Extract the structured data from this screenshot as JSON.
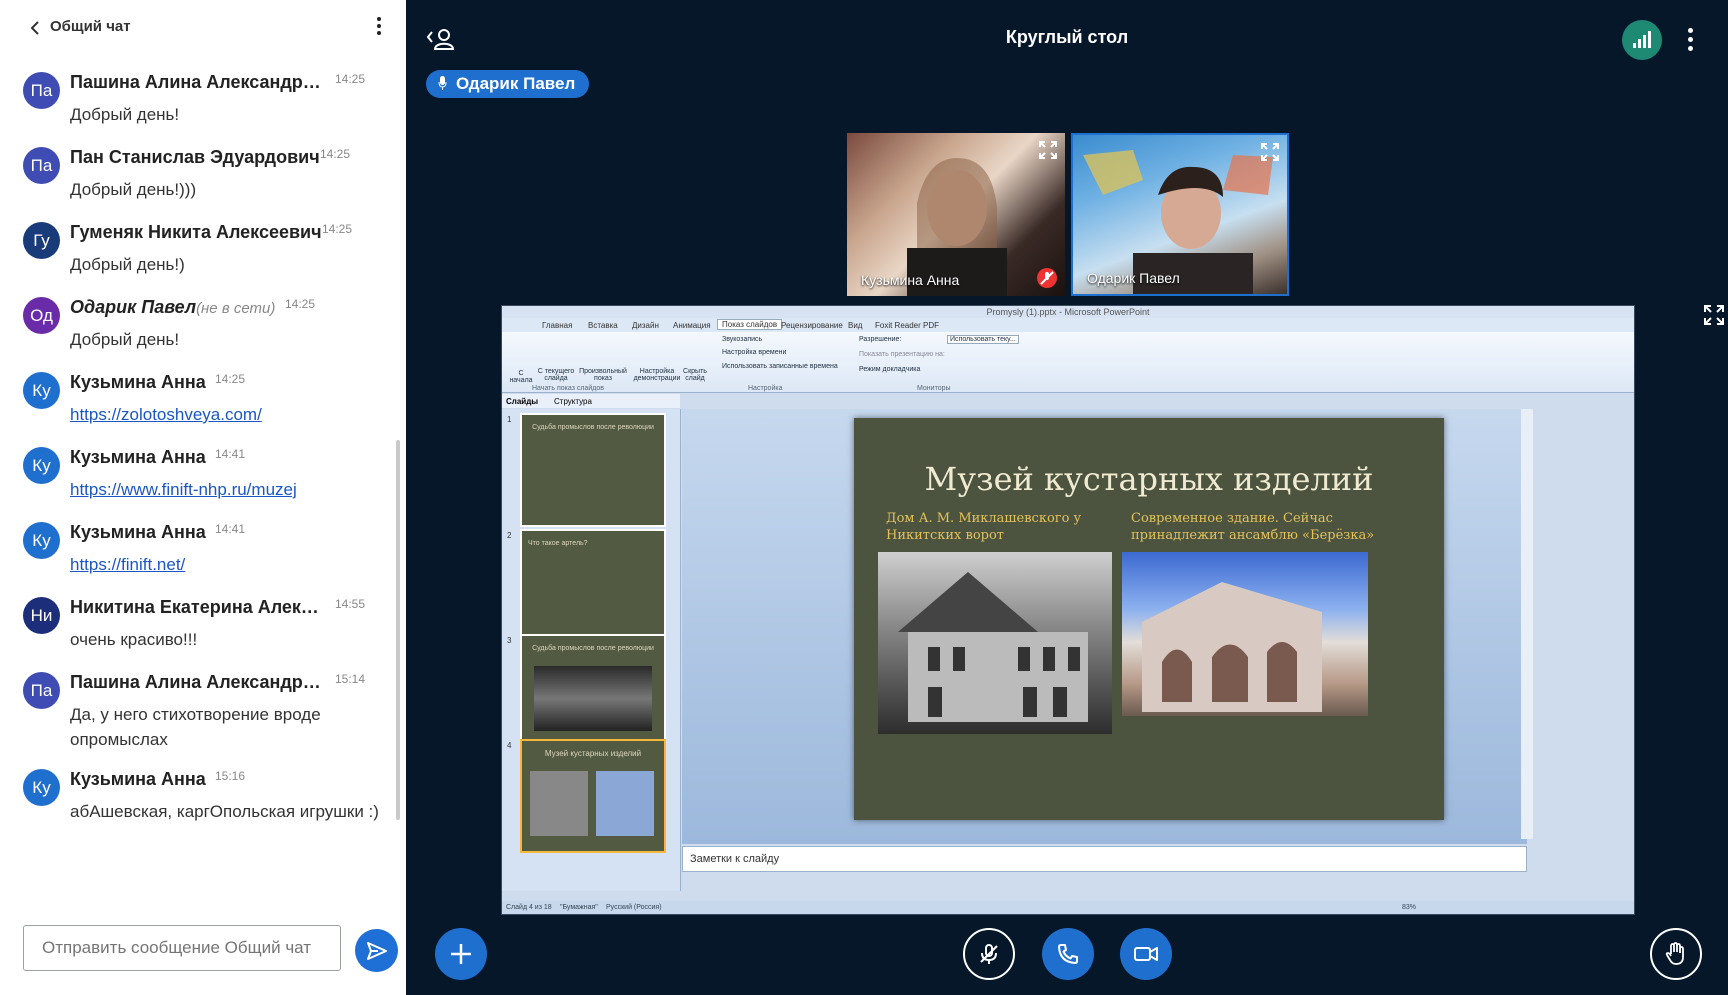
{
  "chat": {
    "title": "Общий чат",
    "input_placeholder": "Отправить сообщение Общий чат",
    "messages": [
      {
        "initials": "Па",
        "color": "#3e4cb3",
        "sender": "Пашина Алина Александро...",
        "note": "",
        "time": "14:25",
        "text": "Добрый день!",
        "link": false
      },
      {
        "initials": "Па",
        "color": "#3e4cb3",
        "sender": "Пан Станислав Эдуардович",
        "note": "",
        "time": "14:25",
        "text": "Добрый день!)))",
        "link": false
      },
      {
        "initials": "Гу",
        "color": "#1a3b7a",
        "sender": "Гуменяк Никита Алексеевич",
        "note": "",
        "time": "14:25",
        "text": "Добрый день!)",
        "link": false
      },
      {
        "initials": "Од",
        "color": "#6a2ba8",
        "sender": "Одарик Павел",
        "note": "(не в сети)",
        "time": "14:25",
        "text": "Добрый день!",
        "link": false
      },
      {
        "initials": "Ку",
        "color": "#1f6fcf",
        "sender": "Кузьмина Анна",
        "note": "",
        "time": "14:25",
        "text": "https://zolotoshveya.com/",
        "link": true
      },
      {
        "initials": "Ку",
        "color": "#1f6fcf",
        "sender": "Кузьмина Анна",
        "note": "",
        "time": "14:41",
        "text": "https://www.finift-nhp.ru/muzej",
        "link": true
      },
      {
        "initials": "Ку",
        "color": "#1f6fcf",
        "sender": "Кузьмина Анна",
        "note": "",
        "time": "14:41",
        "text": "https://finift.net/",
        "link": true
      },
      {
        "initials": "Ни",
        "color": "#1c2d7a",
        "sender": "Никитина Екатерина Алекс...",
        "note": "",
        "time": "14:55",
        "text": "очень красиво!!!",
        "link": false
      },
      {
        "initials": "Па",
        "color": "#3e4cb3",
        "sender": "Пашина Алина Александро...",
        "note": "",
        "time": "15:14",
        "text": "Да, у него стихотворение вроде\nопромыслах",
        "link": false
      },
      {
        "initials": "Ку",
        "color": "#1f6fcf",
        "sender": "Кузьмина Анна",
        "note": "",
        "time": "15:16",
        "text": "абАшевская, каргОпольская игрушки :)",
        "link": false
      }
    ]
  },
  "main": {
    "title": "Круглый стол",
    "speaker": "Одарик Павел",
    "videos": [
      {
        "name": "Кузьмина Анна",
        "muted": true
      },
      {
        "name": "Одарик Павел",
        "muted": false
      }
    ]
  },
  "presentation": {
    "window_title": "Promysly (1).pptx - Microsoft PowerPoint",
    "tabs": [
      "Главная",
      "Вставка",
      "Дизайн",
      "Анимация",
      "Показ слайдов",
      "Рецензирование",
      "Вид",
      "Foxit Reader PDF"
    ],
    "ribbon": {
      "from_start": "С начала",
      "from_current": "С текущего слайда",
      "custom_show": "Произвольный показ",
      "group_start": "Начать показ слайдов",
      "setup": "Настройка демонстрации",
      "hide": "Скрыть слайд",
      "record": "Звукозапись",
      "rehearse": "Настройка времени",
      "use_timings": "Использовать записанные времена",
      "group_setup": "Настройка",
      "resolution": "Разрешение:",
      "resolution_value": "Использовать теку...",
      "show_on": "Показать презентацию на:",
      "presenter_view": "Режим докладчика",
      "group_monitors": "Мониторы"
    },
    "pane_tabs": [
      "Слайды",
      "Структура"
    ],
    "thumbs": [
      {
        "num": "1",
        "title": "Судьба промыслов после революции"
      },
      {
        "num": "2",
        "title": "Что такое артель?"
      },
      {
        "num": "3",
        "title": "Судьба промыслов после революции"
      },
      {
        "num": "4",
        "title": "Музей кустарных изделий"
      }
    ],
    "slide": {
      "title": "Музей кустарных изделий",
      "left_caption": "Дом А. М. Миклашевского у\nНикитских ворот",
      "right_caption": "Современное здание. Сейчас\nпринадлежит ансамблю «Берёзка»"
    },
    "notes_placeholder": "Заметки к слайду",
    "status": {
      "slide": "Слайд 4 из 18",
      "theme": "\"Бумажная\"",
      "lang": "Русский (Россия)",
      "zoom": "83%"
    }
  }
}
